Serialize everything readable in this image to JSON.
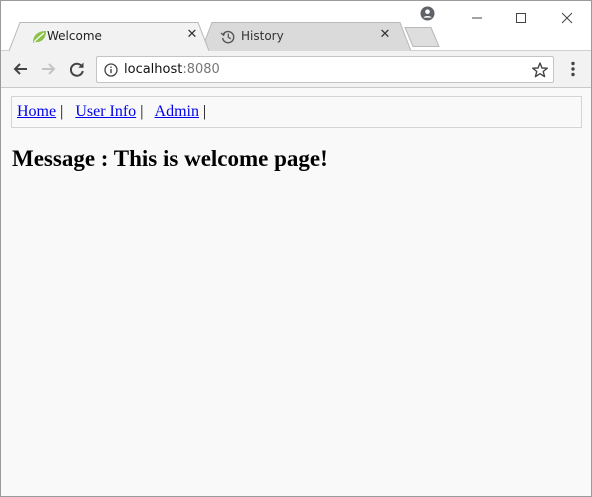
{
  "tabs": [
    {
      "title": "Welcome",
      "close_glyph": "✕",
      "icon": "spring-leaf-icon",
      "active": true
    },
    {
      "title": "History",
      "close_glyph": "✕",
      "icon": "history-icon",
      "active": false
    }
  ],
  "address_bar": {
    "host": "localhost",
    "port": ":8080"
  },
  "page": {
    "nav": [
      {
        "label": "Home",
        "sep": "|"
      },
      {
        "label": "User Info",
        "sep": "|"
      },
      {
        "label": "Admin",
        "sep": "|"
      }
    ],
    "message": "Message : This is welcome page!"
  },
  "colors": {
    "link": "#0000ee",
    "page_background": "#f9f9f9",
    "toolbar": "#f2f2f2",
    "favicon_green": "#8bc34a"
  }
}
